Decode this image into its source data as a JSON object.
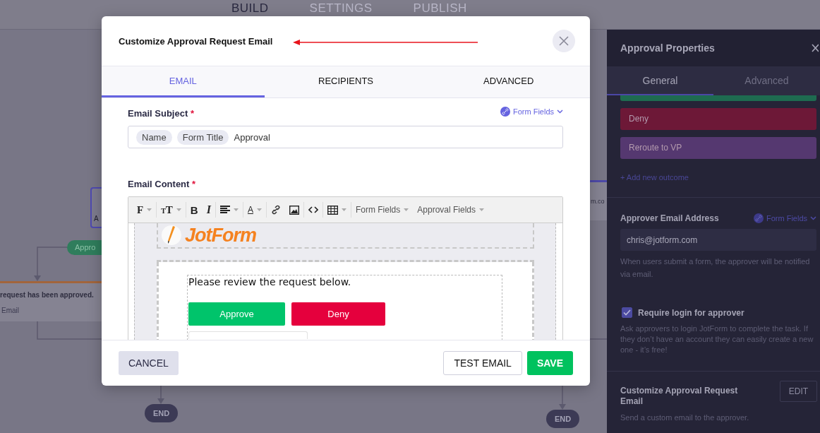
{
  "top_nav": [
    {
      "label": "BUILD",
      "selected": true
    },
    {
      "label": "SETTINGS",
      "selected": false
    },
    {
      "label": "PUBLISH",
      "selected": false
    }
  ],
  "canvas": {
    "node_label": "A",
    "outcome_pill": "Appro",
    "card": {
      "title": "request has been approved.",
      "subtitle": "Email"
    },
    "partial_node_text": "m.co",
    "end_nodes": [
      "END",
      "END"
    ]
  },
  "modal": {
    "title": "Customize Approval Request Email",
    "tabs": [
      {
        "label": "EMAIL",
        "selected": true
      },
      {
        "label": "RECIPIENTS",
        "selected": false
      },
      {
        "label": "ADVANCED",
        "selected": false
      }
    ],
    "subject": {
      "label": "Email Subject",
      "required_mark": "*",
      "link": "Form Fields",
      "tags": [
        "Name",
        "Form Title"
      ],
      "value": "Approval"
    },
    "content": {
      "label": "Email Content",
      "required_mark": "*",
      "toolbar": [
        {
          "kind": "font",
          "text": "F",
          "dropdown": true,
          "group_end": true
        },
        {
          "kind": "size",
          "text": "TT",
          "dropdown": true,
          "group_end": true
        },
        {
          "kind": "bold",
          "text": "B",
          "dropdown": false,
          "group_end": false
        },
        {
          "kind": "italic",
          "text": "I",
          "dropdown": false,
          "group_end": true
        },
        {
          "kind": "align",
          "dropdown": true,
          "group_end": true
        },
        {
          "kind": "color",
          "text": "A",
          "dropdown": true,
          "group_end": true
        },
        {
          "kind": "link",
          "dropdown": false,
          "group_end": false
        },
        {
          "kind": "image",
          "dropdown": false,
          "group_end": true
        },
        {
          "kind": "code",
          "dropdown": false,
          "group_end": true
        },
        {
          "kind": "table",
          "dropdown": true,
          "group_end": true
        },
        {
          "kind": "menu",
          "text": "Form Fields",
          "dropdown": true,
          "group_end": false
        },
        {
          "kind": "menu",
          "text": "Approval Fields",
          "dropdown": true,
          "group_end": false
        }
      ],
      "preview": {
        "logo": "JotForm",
        "message": "Please review the request below.",
        "buttons": [
          {
            "label": "Approve",
            "color": "#00c46b"
          },
          {
            "label": "Deny",
            "color": "#e5003d"
          }
        ]
      }
    },
    "buttons": [
      {
        "label": "CANCEL",
        "kind": "secondary"
      },
      {
        "label": "TEST EMAIL",
        "kind": "outline"
      },
      {
        "label": "SAVE",
        "kind": "primary"
      }
    ]
  },
  "panel": {
    "title": "Approval Properties",
    "tabs": [
      {
        "label": "General",
        "selected": true
      },
      {
        "label": "Advanced",
        "selected": false
      }
    ],
    "outcomes": [
      {
        "color": "#1e6b50"
      },
      {
        "label": "Deny",
        "color": "#6d1837"
      },
      {
        "label": "Reroute to VP",
        "color": "#553870"
      }
    ],
    "add_outcome": "+ Add new outcome",
    "approver_email": {
      "label": "Approver Email Address",
      "link": "Form Fields",
      "value": "chris@jotform.com",
      "help": "When users submit a form, the approver will be notified via email."
    },
    "require_login": {
      "label": "Require login for approver",
      "checked": true,
      "help": "Ask approvers to login JotForm to complete the task. If they don’t have an account they can easily create a new one - it’s free!"
    },
    "customize": {
      "title": "Customize Approval Request Email",
      "button": "EDIT",
      "help": "Send a custom email to the approver."
    }
  }
}
